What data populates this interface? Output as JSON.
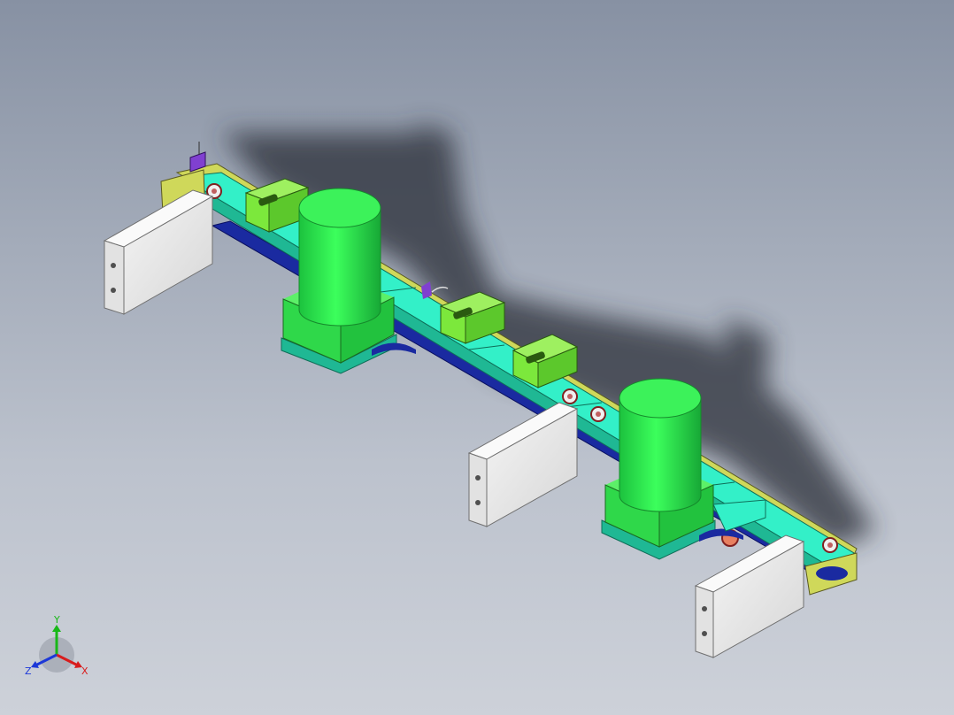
{
  "viewport": {
    "background_top": "#8791a3",
    "background_bottom": "#cdd1d9"
  },
  "model": {
    "colors": {
      "rail": "#33f0c8",
      "rail_dark": "#1fb894",
      "motor": "#22e84a",
      "motor_dark": "#17b536",
      "bracket": "#7ce83c",
      "plate": "#e9e9e9",
      "yellow_part": "#cfd85a",
      "blue_part": "#1a2aa0",
      "shadow": "#2a2e38"
    }
  },
  "triad": {
    "x_label": "X",
    "y_label": "Y",
    "z_label": "Z",
    "x_color": "#d81c1c",
    "y_color": "#18b818",
    "z_color": "#1c38d8",
    "icon": "coordinate-triad-icon"
  }
}
